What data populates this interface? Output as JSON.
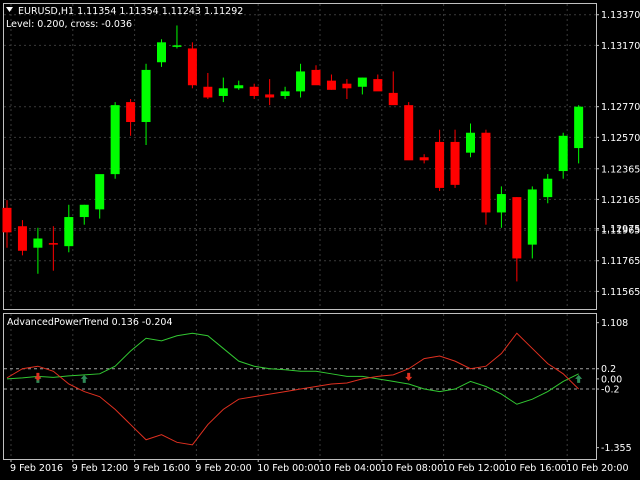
{
  "header": {
    "symbol_line": "EURUSD,H1  1.11354 1.11354 1.11243 1.11292",
    "info_line": "Level: 0.200, cross: -0.036"
  },
  "indicator": {
    "label": "AdvancedPowerTrend 0.136 -0.204"
  },
  "colors": {
    "background": "#000000",
    "bull": "#00ff00",
    "bear": "#ff0000",
    "border": "#c0c0c0",
    "grid": "#3a3a3a",
    "level_line": "#a0a0a0",
    "green_line": "#32c832",
    "red_line": "#e03020"
  },
  "icons": {
    "dropdown": "triangle-down-icon",
    "buy_arrow": "up-arrow-icon",
    "sell_arrow": "down-arrow-icon"
  },
  "chart_data": [
    {
      "type": "candlestick",
      "title": "EURUSD,H1",
      "ylim": [
        1.1145,
        1.1344
      ],
      "y_ticks": [
        1.1337,
        1.1317,
        1.11975,
        1.1277,
        1.1257,
        1.12365,
        1.12165,
        1.11965,
        1.11765,
        1.11565
      ],
      "y_tick_labels": [
        "1.13370",
        "1.13170",
        "1.12975",
        "1.12770",
        "1.12570",
        "1.12365",
        "1.12165",
        "1.11965",
        "1.11765",
        "1.11565"
      ],
      "x_tick_labels": [
        "9 Feb 2016",
        "9 Feb 12:00",
        "9 Feb 16:00",
        "9 Feb 20:00",
        "10 Feb 00:00",
        "10 Feb 04:00",
        "10 Feb 08:00",
        "10 Feb 12:00",
        "10 Feb 16:00",
        "10 Feb 20:00"
      ],
      "x_tick_bar_index": [
        0,
        4,
        8,
        12,
        16,
        20,
        24,
        28,
        32,
        36
      ],
      "candles": [
        {
          "o": 1.1211,
          "h": 1.1216,
          "l": 1.1185,
          "c": 1.1195
        },
        {
          "o": 1.1199,
          "h": 1.1203,
          "l": 1.118,
          "c": 1.1183
        },
        {
          "o": 1.1185,
          "h": 1.1198,
          "l": 1.1168,
          "c": 1.1191
        },
        {
          "o": 1.1188,
          "h": 1.1199,
          "l": 1.117,
          "c": 1.1187
        },
        {
          "o": 1.1186,
          "h": 1.1213,
          "l": 1.1182,
          "c": 1.1205
        },
        {
          "o": 1.1205,
          "h": 1.1213,
          "l": 1.12,
          "c": 1.1213
        },
        {
          "o": 1.121,
          "h": 1.1232,
          "l": 1.1204,
          "c": 1.1233
        },
        {
          "o": 1.1233,
          "h": 1.128,
          "l": 1.123,
          "c": 1.1278
        },
        {
          "o": 1.128,
          "h": 1.1282,
          "l": 1.1258,
          "c": 1.1267
        },
        {
          "o": 1.1267,
          "h": 1.1305,
          "l": 1.1252,
          "c": 1.1301
        },
        {
          "o": 1.1306,
          "h": 1.1321,
          "l": 1.1303,
          "c": 1.1319
        },
        {
          "o": 1.1317,
          "h": 1.133,
          "l": 1.1315,
          "c": 1.1317
        },
        {
          "o": 1.1315,
          "h": 1.1319,
          "l": 1.1289,
          "c": 1.1291
        },
        {
          "o": 1.129,
          "h": 1.1299,
          "l": 1.1282,
          "c": 1.1283
        },
        {
          "o": 1.1284,
          "h": 1.1296,
          "l": 1.128,
          "c": 1.1289
        },
        {
          "o": 1.1289,
          "h": 1.1294,
          "l": 1.1288,
          "c": 1.1291
        },
        {
          "o": 1.129,
          "h": 1.1292,
          "l": 1.1282,
          "c": 1.1284
        },
        {
          "o": 1.1285,
          "h": 1.1295,
          "l": 1.1278,
          "c": 1.1283
        },
        {
          "o": 1.1284,
          "h": 1.129,
          "l": 1.1282,
          "c": 1.1287
        },
        {
          "o": 1.1287,
          "h": 1.1305,
          "l": 1.1283,
          "c": 1.13
        },
        {
          "o": 1.1301,
          "h": 1.1304,
          "l": 1.1298,
          "c": 1.1291
        },
        {
          "o": 1.1294,
          "h": 1.1298,
          "l": 1.1288,
          "c": 1.1288
        },
        {
          "o": 1.1292,
          "h": 1.1295,
          "l": 1.1282,
          "c": 1.1289
        },
        {
          "o": 1.129,
          "h": 1.1296,
          "l": 1.1285,
          "c": 1.1296
        },
        {
          "o": 1.1295,
          "h": 1.1298,
          "l": 1.129,
          "c": 1.1287
        },
        {
          "o": 1.1286,
          "h": 1.13,
          "l": 1.128,
          "c": 1.1278
        },
        {
          "o": 1.1278,
          "h": 1.128,
          "l": 1.1243,
          "c": 1.1242
        },
        {
          "o": 1.1244,
          "h": 1.1246,
          "l": 1.124,
          "c": 1.1242
        },
        {
          "o": 1.1254,
          "h": 1.1262,
          "l": 1.1222,
          "c": 1.1224
        },
        {
          "o": 1.1254,
          "h": 1.1262,
          "l": 1.1224,
          "c": 1.1226
        },
        {
          "o": 1.1247,
          "h": 1.1266,
          "l": 1.1244,
          "c": 1.126
        },
        {
          "o": 1.126,
          "h": 1.1262,
          "l": 1.12,
          "c": 1.1208
        },
        {
          "o": 1.1208,
          "h": 1.1225,
          "l": 1.1198,
          "c": 1.122
        },
        {
          "o": 1.1218,
          "h": 1.1218,
          "l": 1.1163,
          "c": 1.1178
        },
        {
          "o": 1.1187,
          "h": 1.1225,
          "l": 1.1178,
          "c": 1.1223
        },
        {
          "o": 1.1218,
          "h": 1.1233,
          "l": 1.1214,
          "c": 1.123
        },
        {
          "o": 1.1235,
          "h": 1.126,
          "l": 1.123,
          "c": 1.1258
        },
        {
          "o": 1.125,
          "h": 1.1278,
          "l": 1.124,
          "c": 1.1277
        }
      ]
    },
    {
      "type": "line",
      "title": "AdvancedPowerTrend",
      "ylim": [
        -1.5,
        1.2
      ],
      "y_tick_labels": [
        "1.108",
        "0.2",
        "0.00",
        "-0.2",
        "-1.355"
      ],
      "y_ticks": [
        1.108,
        0.2,
        0.0,
        -0.2,
        -1.355
      ],
      "levels": [
        0.2,
        -0.2
      ],
      "series": [
        {
          "name": "",
          "color": "green",
          "values": [
            0.0,
            0.02,
            0.05,
            0.03,
            0.06,
            0.08,
            0.1,
            0.25,
            0.55,
            0.8,
            0.75,
            0.85,
            0.9,
            0.85,
            0.6,
            0.35,
            0.25,
            0.2,
            0.18,
            0.15,
            0.15,
            0.1,
            0.05,
            0.05,
            0.0,
            -0.05,
            -0.1,
            -0.2,
            -0.25,
            -0.2,
            -0.05,
            -0.15,
            -0.3,
            -0.5,
            -0.4,
            -0.25,
            -0.05,
            0.1
          ]
        },
        {
          "name": "",
          "color": "red",
          "values": [
            0.02,
            0.2,
            0.25,
            0.15,
            -0.1,
            -0.25,
            -0.35,
            -0.6,
            -0.9,
            -1.2,
            -1.1,
            -1.25,
            -1.3,
            -0.9,
            -0.6,
            -0.4,
            -0.35,
            -0.3,
            -0.25,
            -0.2,
            -0.15,
            -0.1,
            -0.08,
            0.0,
            0.05,
            0.08,
            0.2,
            0.4,
            0.45,
            0.35,
            0.2,
            0.25,
            0.5,
            0.9,
            0.6,
            0.3,
            0.1,
            -0.2
          ]
        }
      ],
      "buy_arrows": [
        2,
        5,
        37
      ],
      "sell_arrows": [
        2,
        26
      ]
    }
  ]
}
